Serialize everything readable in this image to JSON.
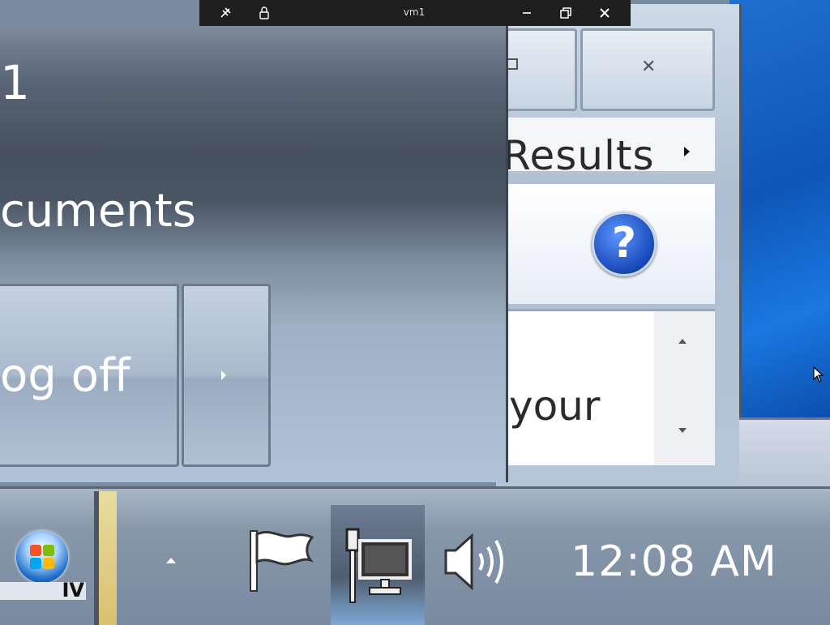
{
  "remote_toolbar": {
    "title": "vm1",
    "icons": [
      "pin-off-icon",
      "lock-icon",
      "minimize-icon",
      "restore-icon",
      "close-icon"
    ]
  },
  "background_window": {
    "results_label": "Results",
    "help_icon_glyph": "?",
    "list_text": "your"
  },
  "start_menu": {
    "user_name": "1",
    "documents_label": "cuments",
    "logoff_label": "og off"
  },
  "taskbar": {
    "start_button": "start-orb",
    "task_strip_text": "IV",
    "clock": "12:08 AM",
    "tray_icons": [
      "show-hidden-icons-arrow",
      "action-center-flag-icon",
      "network-icon",
      "volume-icon"
    ]
  },
  "colors": {
    "desktop_blue": "#1f6fd0",
    "taskbar": "#8797aa",
    "toolbar": "#1e1e1e"
  }
}
